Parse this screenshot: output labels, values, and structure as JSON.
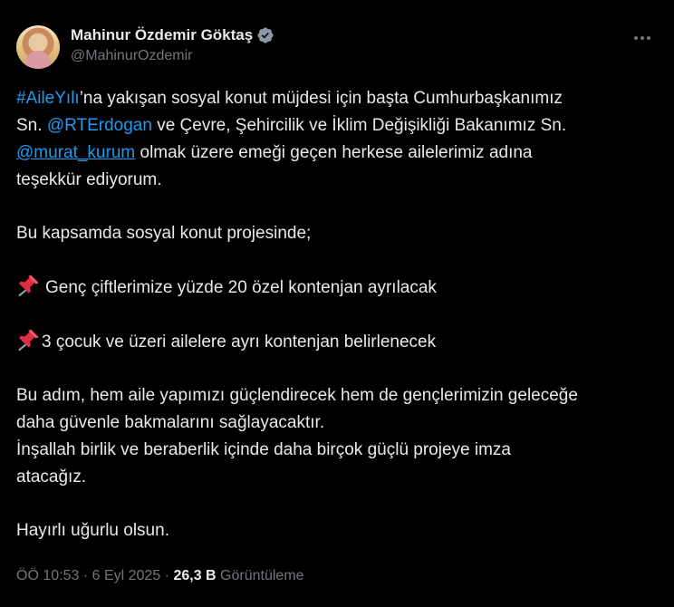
{
  "author": {
    "display_name": "Mahinur Özdemir Göktaş",
    "handle": "@MahinurOzdemir",
    "verified": true
  },
  "tweet": {
    "line1": {
      "hashtag": "#AileYılı",
      "text": "’na yakışan sosyal konut müjdesi için başta Cumhurbaşkanımız"
    },
    "line2": {
      "prefix": "Sn. ",
      "mention": "@RTErdogan",
      "text": " ve Çevre, Şehircilik ve İklim Değişikliği Bakanımız Sn."
    },
    "line3": {
      "mention": "@murat_kurum",
      "text": " olmak üzere emeği geçen herkese ailelerimiz adına"
    },
    "line4": "teşekkür ediyorum.",
    "para2": "Bu kapsamda sosyal konut projesinde;",
    "bullet1": "Genç çiftlerimize yüzde 20 özel kontenjan ayrılacak",
    "bullet2": "3 çocuk ve üzeri ailelere ayrı kontenjan belirlenecek",
    "para3_line1": "Bu adım, hem aile yapımızı güçlendirecek hem de gençlerimizin geleceğe",
    "para3_line2": "daha güvenle bakmalarını sağlayacaktır.",
    "para3_line3": "İnşallah birlik ve beraberlik içinde daha birçok güçlü projeye imza",
    "para3_line4": "atacağız.",
    "closing": "Hayırlı uğurlu olsun."
  },
  "meta": {
    "time": "ÖÖ 10:53",
    "separator": "·",
    "date": "6 Eyl 2025",
    "views_count": "26,3 B",
    "views_label": "Görüntüleme"
  },
  "icons": {
    "verified": "verified-badge-icon",
    "more": "more-horizontal-icon",
    "pin": "pushpin-icon"
  },
  "colors": {
    "background": "#000000",
    "text": "#e7e9ea",
    "secondary": "#71767b",
    "link": "#1d9bf0"
  }
}
